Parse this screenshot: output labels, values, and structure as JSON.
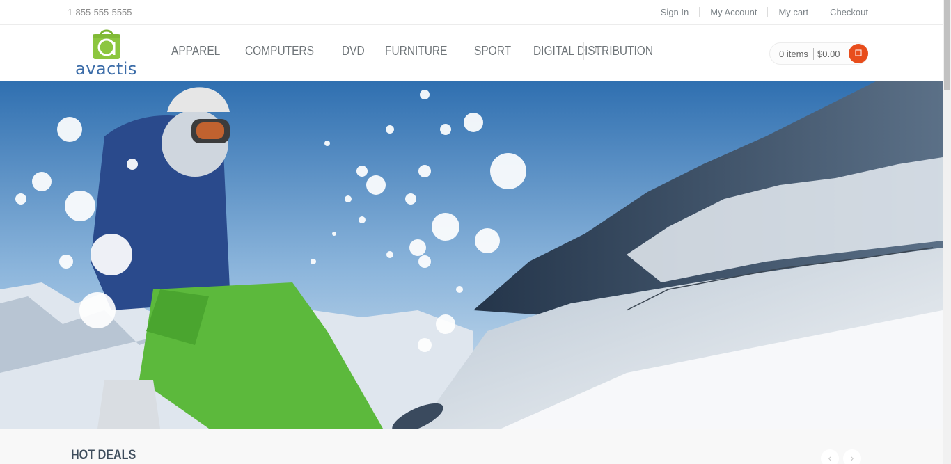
{
  "topbar": {
    "phone": "1-855-555-5555",
    "links": [
      "Sign In",
      "My Account",
      "My cart",
      "Checkout"
    ]
  },
  "header": {
    "logo_text": "avactis",
    "logo_letter": "a",
    "nav": [
      "APPAREL",
      "COMPUTERS",
      "DVD",
      "FURNITURE",
      "SPORT",
      "DIGITAL DISTRIBUTION"
    ],
    "search_icon": "search-icon",
    "cart": {
      "items": "0 items",
      "total": "$0.00",
      "icon": "cart-icon"
    }
  },
  "hero": {
    "image": "snowboarder-mountain-banner"
  },
  "hot_deals": {
    "title": "HOT DEALS",
    "prev_icon": "chevron-left-icon",
    "next_icon": "chevron-right-icon"
  },
  "colors": {
    "accent": "#e84d1c",
    "logo_green": "#8cc63f",
    "logo_blue": "#3b6ca8"
  }
}
